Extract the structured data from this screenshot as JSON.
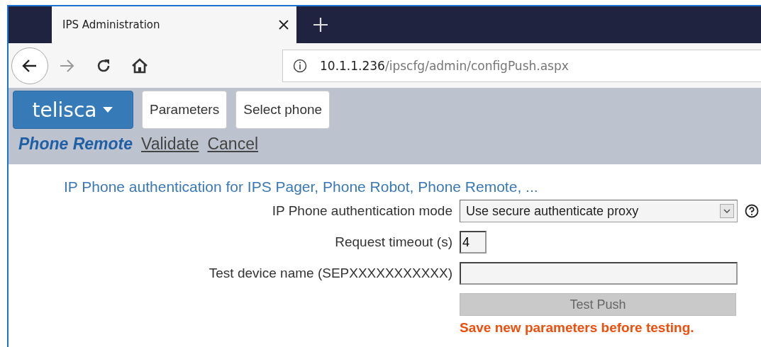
{
  "browser": {
    "tab": {
      "title": "IPS Administration"
    },
    "url": {
      "host": "10.1.1.236",
      "path": "/ipscfg/admin/configPush.aspx"
    }
  },
  "app": {
    "logo": "telisca",
    "menu_buttons": [
      "Parameters",
      "Select phone"
    ],
    "nav": [
      {
        "label": "Phone Remote",
        "selected": true
      },
      {
        "label": "Validate",
        "selected": false
      },
      {
        "label": "Cancel",
        "selected": false
      }
    ]
  },
  "section_title": "IP Phone authentication for IPS Pager, Phone Robot, Phone Remote, ...",
  "fields": [
    {
      "kind": "select",
      "label": "IP Phone authentication mode",
      "value": "Use secure authenticate proxy"
    },
    {
      "kind": "short",
      "label": "Request timeout (s)",
      "value": "4"
    },
    {
      "kind": "text",
      "label": "Test device name (SEPXXXXXXXXXXX)"
    }
  ],
  "test_button": {
    "label": "Test Push",
    "disabled": true
  },
  "warning": "Save new parameters before testing."
}
